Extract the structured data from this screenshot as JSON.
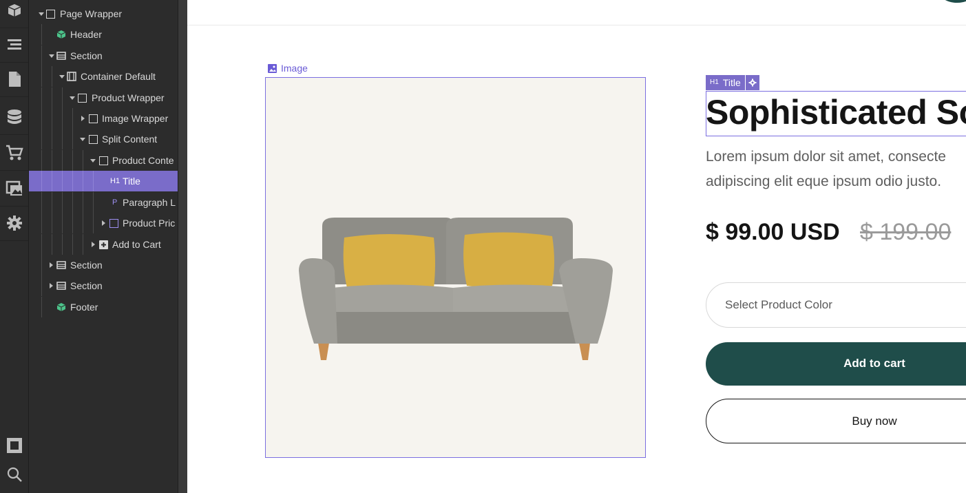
{
  "navigator": {
    "items": [
      {
        "label": "Page Wrapper",
        "icon": "box-outline-icon"
      },
      {
        "label": "Header",
        "icon": "component-icon"
      },
      {
        "label": "Section",
        "icon": "section-icon"
      },
      {
        "label": "Container Default",
        "icon": "container-icon"
      },
      {
        "label": "Product Wrapper",
        "icon": "box-outline-icon"
      },
      {
        "label": "Image Wrapper",
        "icon": "box-outline-icon"
      },
      {
        "label": "Split Content",
        "icon": "box-outline-icon"
      },
      {
        "label": "Product Conte",
        "icon": "box-outline-icon"
      },
      {
        "label": "Title",
        "icon": "heading-icon",
        "tag": "H1"
      },
      {
        "label": "Paragraph L",
        "icon": "paragraph-icon",
        "tag": "P"
      },
      {
        "label": "Product Pric",
        "icon": "box-outline-icon"
      },
      {
        "label": "Add to Cart",
        "icon": "add-to-cart-icon"
      },
      {
        "label": "Section",
        "icon": "section-icon"
      },
      {
        "label": "Section",
        "icon": "section-icon"
      },
      {
        "label": "Footer",
        "icon": "component-icon"
      }
    ]
  },
  "canvas": {
    "image_tag": "Image",
    "title_tag": "Title",
    "title_tag_badge": "H1",
    "title": "Sophisticated So",
    "paragraph_line1": "Lorem ipsum dolor sit amet, consecte",
    "paragraph_line2": "adipiscing elit eque ipsum odio justo.",
    "price": "$ 99.00 USD",
    "old_price": "$ 199.00",
    "select_placeholder": "Select Product Color",
    "add_to_cart": "Add to cart",
    "buy_now": "Buy now"
  },
  "colors": {
    "accent": "#7a6cc9",
    "brand": "#1f4d4a",
    "component_green": "#4cc38a"
  }
}
